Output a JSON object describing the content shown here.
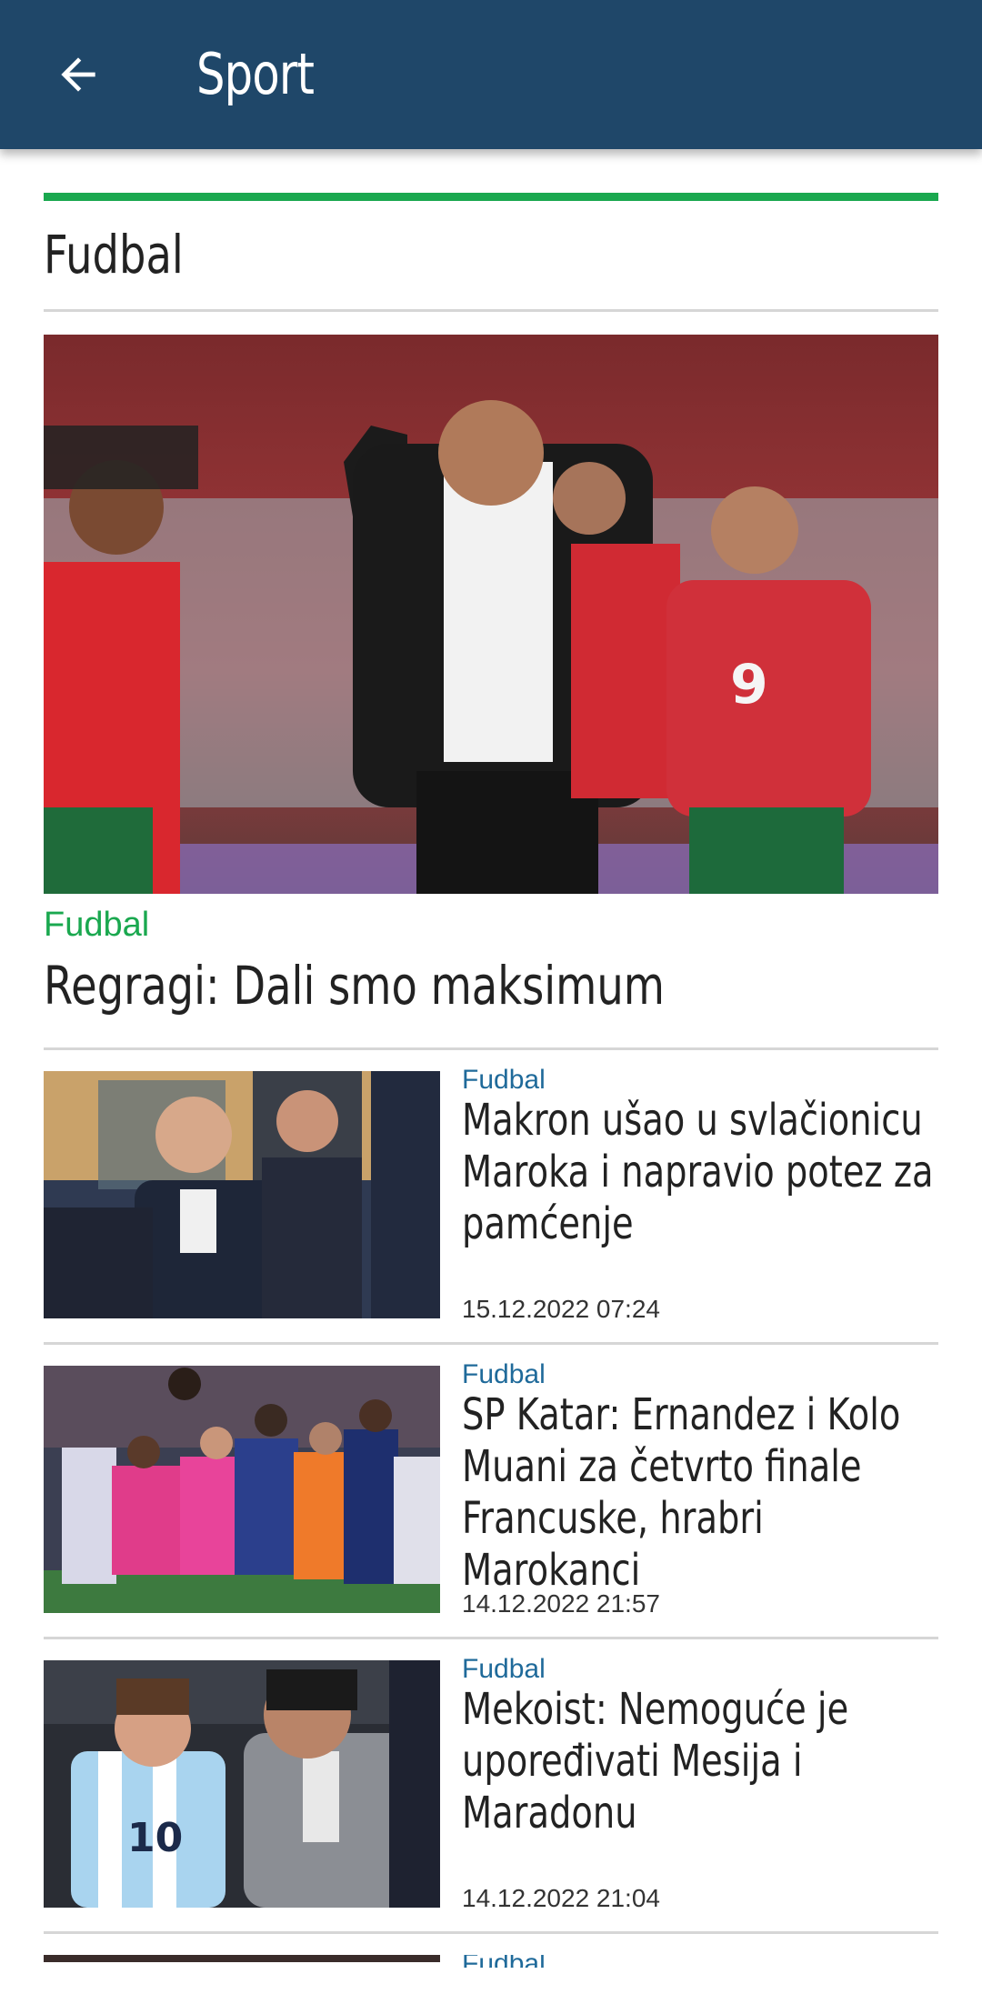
{
  "appbar": {
    "title": "Sport",
    "back_icon": "arrow-left-icon"
  },
  "section": {
    "title": "Fudbal",
    "accent": "#1aa84f"
  },
  "hero": {
    "category": "Fudbal",
    "title": "Regragi: Dali smo maksimum"
  },
  "articles": [
    {
      "category": "Fudbal",
      "title": "Makron ušao u svlačionicu Maroka i napravio potez za pamćenje",
      "date": "15.12.2022 07:24"
    },
    {
      "category": "Fudbal",
      "title": "SP Katar: Ernandez i Kolo Muani za četvrto finale Francuske, hrabri Marokanci",
      "date": "14.12.2022 21:57"
    },
    {
      "category": "Fudbal",
      "title": "Mekoist: Nemoguće je upoređivati Mesija i Maradonu",
      "date": "14.12.2022 21:04"
    },
    {
      "category": "Fudbal"
    }
  ],
  "colors": {
    "appbar": "#1f4769",
    "category_green": "#1aa84f",
    "category_blue": "#1f6a9a"
  }
}
